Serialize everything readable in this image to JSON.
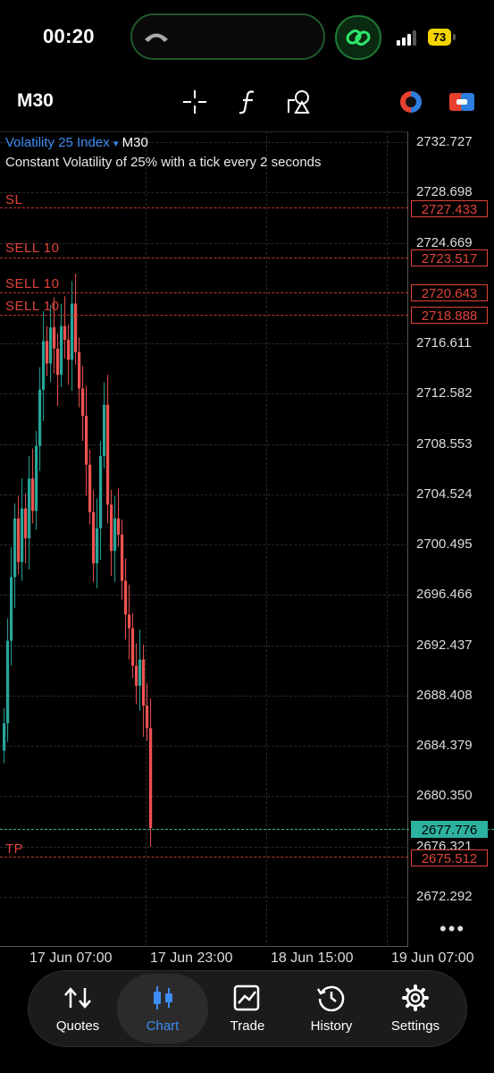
{
  "status_bar": {
    "time": "00:20",
    "battery": "73",
    "icons": [
      "phone-hangup-icon",
      "link-icon",
      "signal-icon",
      "battery-icon"
    ]
  },
  "toolbar": {
    "timeframe": "M30",
    "icons": [
      "crosshair-icon",
      "indicator-f-icon",
      "objects-icon",
      "trade-mode-icon",
      "color-scheme-icon"
    ]
  },
  "chart": {
    "symbol": "Volatility 25 Index",
    "symbol_caret": "▾",
    "timeframe": "M30",
    "description": "Constant Volatility of 25% with a tick every 2 seconds",
    "price_axis": [
      "2732.727",
      "2728.698",
      "2724.669",
      "2716.611",
      "2712.582",
      "2708.553",
      "2704.524",
      "2700.495",
      "2696.466",
      "2692.437",
      "2688.408",
      "2684.379",
      "2680.350",
      "2676.321",
      "2672.292"
    ],
    "time_axis": [
      "17 Jun 07:00",
      "17 Jun 23:00",
      "18 Jun 15:00",
      "19 Jun 07:00"
    ],
    "trade_lines": [
      {
        "label": "SL",
        "price": "2727.433"
      },
      {
        "label": "SELL 10",
        "price": "2723.517"
      },
      {
        "label": "SELL 10",
        "price": "2720.643"
      },
      {
        "label": "SELL 10",
        "price": "2718.888"
      },
      {
        "label": "TP",
        "price": "2675.512"
      }
    ],
    "current_price": "2677.776",
    "more": "•••",
    "colors": {
      "bull": "#26a69a",
      "bear": "#ef5350",
      "trade": "#e0433a",
      "symbol": "#3d8df5"
    }
  },
  "nav": {
    "items": [
      {
        "label": "Quotes",
        "icon": "quotes-arrows-icon"
      },
      {
        "label": "Chart",
        "icon": "candlestick-icon"
      },
      {
        "label": "Trade",
        "icon": "trade-chart-icon"
      },
      {
        "label": "History",
        "icon": "history-clock-icon"
      },
      {
        "label": "Settings",
        "icon": "gear-icon"
      }
    ],
    "active": "Chart"
  }
}
